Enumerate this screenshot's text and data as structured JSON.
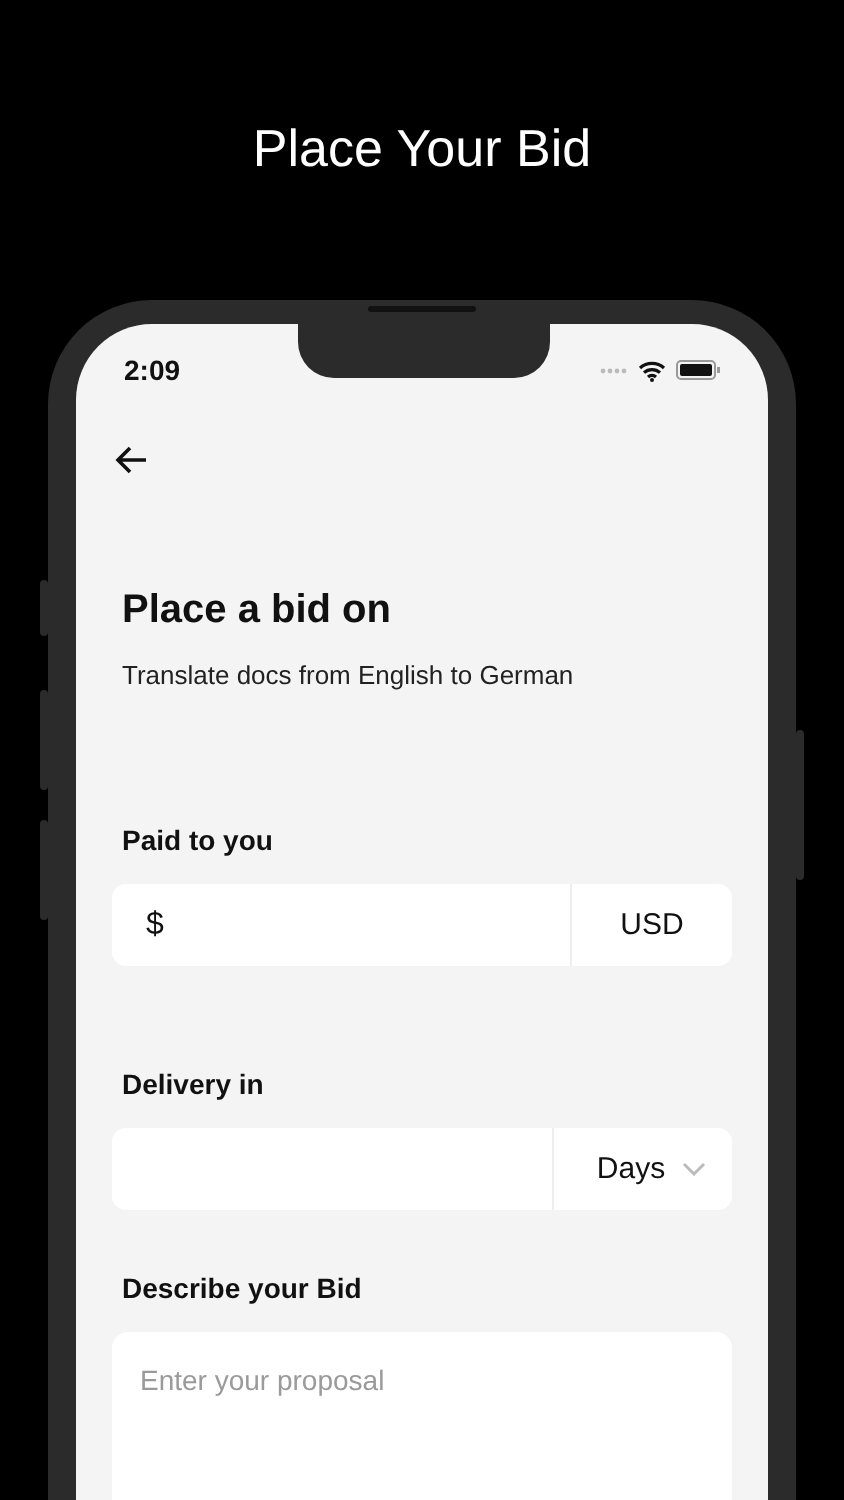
{
  "page_title": "Place Your Bid",
  "status_bar": {
    "time": "2:09"
  },
  "screen": {
    "title": "Place a bid on",
    "subtitle": "Translate docs from English to German",
    "fields": [
      {
        "kind": "amount",
        "label": "Paid to you",
        "prefix": "$",
        "unit": "USD"
      },
      {
        "kind": "dropdown",
        "label": "Delivery in",
        "unit": "Days"
      },
      {
        "kind": "textarea",
        "label": "Describe your Bid",
        "placeholder": "Enter your proposal"
      }
    ]
  }
}
